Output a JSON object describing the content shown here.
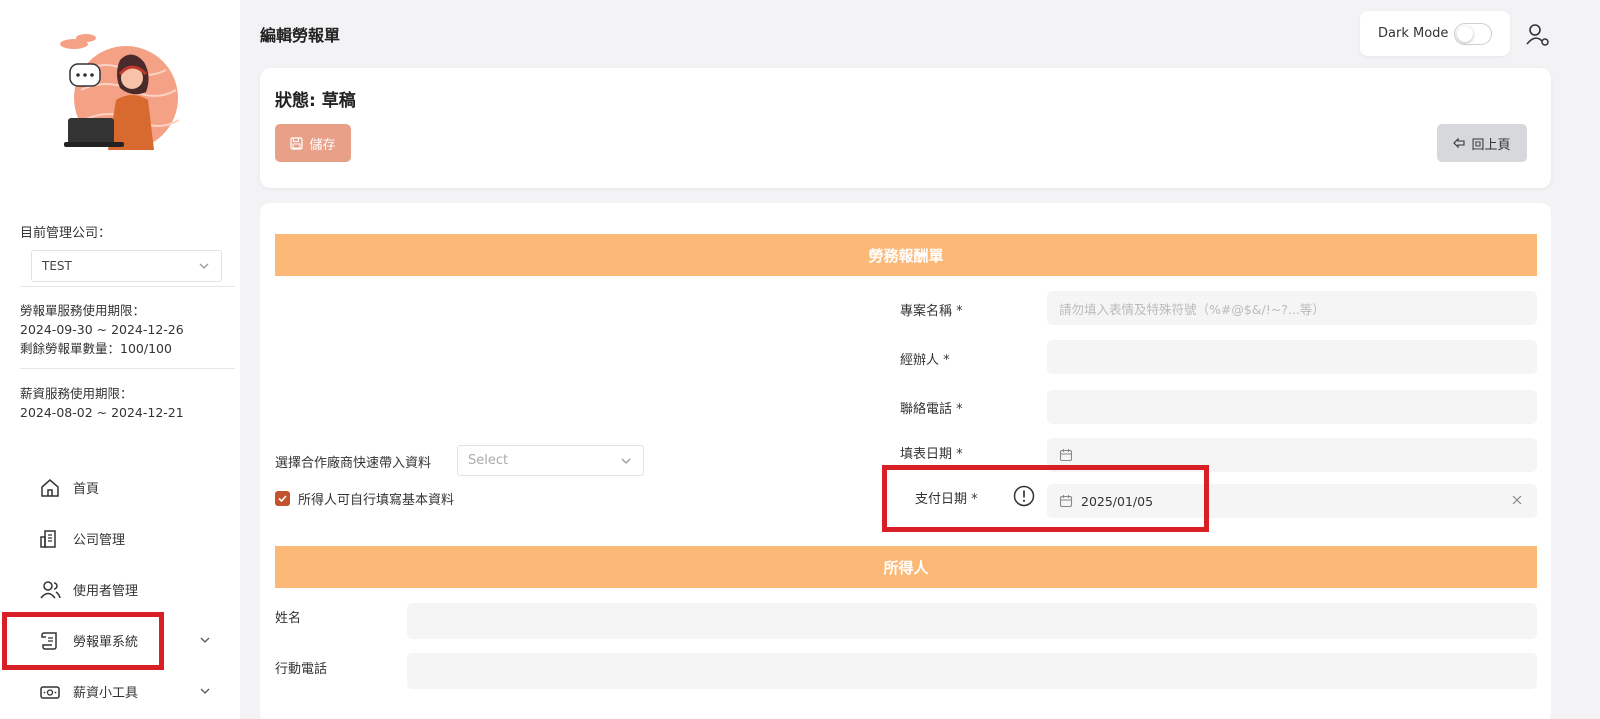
{
  "header": {
    "title": "編輯勞報單",
    "dark_mode_label": "Dark Mode"
  },
  "sidebar": {
    "company_label": "目前管理公司：",
    "company_value": "TEST",
    "labor_service": {
      "line1": "勞報單服務使用期限：",
      "line2": "2024-09-30 ~ 2024-12-26",
      "line3": "剩餘勞報單數量：100/100"
    },
    "salary_service": {
      "line1": "薪資服務使用期限：",
      "line2": "2024-08-02 ~ 2024-12-21"
    },
    "nav": [
      {
        "label": "首頁",
        "icon": "home-icon"
      },
      {
        "label": "公司管理",
        "icon": "building-icon"
      },
      {
        "label": "使用者管理",
        "icon": "users-icon"
      },
      {
        "label": "勞報單系統",
        "icon": "scroll-icon"
      },
      {
        "label": "薪資小工具",
        "icon": "money-icon"
      }
    ]
  },
  "status": {
    "title": "狀態: 草稿",
    "save_label": "儲存",
    "back_label": "回上頁"
  },
  "form": {
    "section_main": "勞務報酬單",
    "section_payee": "所得人",
    "project_label": "專案名稱 *",
    "project_placeholder": "請勿填入表情及特殊符號（%#@$&/!~?...等）",
    "handler_label": "經辦人 *",
    "phone_label": "聯絡電話 *",
    "fill_date_label": "填表日期 *",
    "pay_date_label": "支付日期 *",
    "pay_date_value": "2025/01/05",
    "partner_label": "選擇合作廠商快速帶入資料",
    "partner_placeholder": "Select",
    "self_fill_label": "所得人可自行填寫基本資料",
    "name_label": "姓名",
    "mobile_label": "行動電話"
  },
  "colors": {
    "accent": "#fbb877",
    "save_button": "#e8a089",
    "highlight": "#d81f26",
    "checkbox": "#c2532e"
  }
}
